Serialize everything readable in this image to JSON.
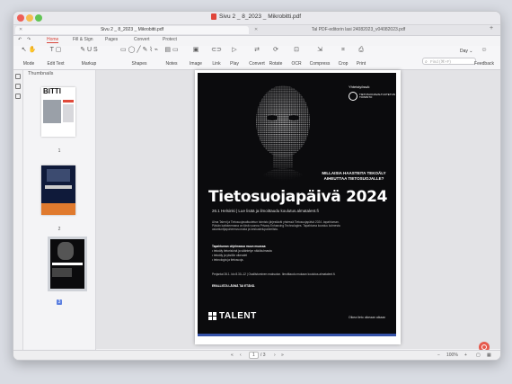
{
  "window": {
    "title": "Sivu 2 _ 8_2023 _ Mikrobitti.pdf"
  },
  "tabs": [
    {
      "label": "Sivu 2 _ 8_2023 _ Mikrobitti.pdf",
      "active": true
    },
    {
      "label": "Tal PDF-editorin lasi 24082023_v04082023.pdf",
      "active": false
    }
  ],
  "menu": [
    "Home",
    "Fill & Sign",
    "Pages",
    "Convert",
    "Protect"
  ],
  "toolbar": {
    "mode": "Mode",
    "edit_text": "Edit Text",
    "markup": "Markup",
    "shapes": "Shapes",
    "notes": "Notes",
    "image": "Image",
    "link": "Link",
    "play": "Play",
    "convert": "Convert",
    "rotate": "Rotate",
    "ocr": "OCR",
    "compress": "Compress",
    "crop": "Crop",
    "print": "Print",
    "feedback": "Feedback",
    "day": "Day",
    "search_placeholder": "Find (⌘+F)"
  },
  "sidebar": {
    "heading": "Thumbnails",
    "pages": [
      "1",
      "2",
      "3"
    ],
    "selected_page": 3
  },
  "poster": {
    "logo_line1": "Yhteistyössä:",
    "logo_line2": "TIETOSUOJAVALTUUTETUN TOIMISTO",
    "question": "MILLAISIA HAASTEITA TEKOÄLY AIHEUTTAA TIETOSUOJALLE?",
    "title": "Tietosuojapäivä 2024",
    "subtitle": "26.1 Helsinki | Lue lisää ja ilmoittaudu koulutus.almatalent.fi",
    "body": "Alma Talent ja Tietosuojavaltuutetun toimisto järjestävät yhdessä Tietosuojapäivä 2024 -tapahtuman. Päivän kattoteemana on tänä vuonna Privacy Enhancing Technologies. Tapahtuma koostuu kolmesta asiantuntijapuheenvuorosta ja keskustelupaneelista.",
    "bullets_title": "Tapahtuman ohjelmassa muun muassa:",
    "bullets": [
      "tekoäly tietoriskinä ja sääntelyn näkökulmasta",
      "tekoäly ja yksilön oikeudet",
      "teknologia ja tietosuoja."
    ],
    "date": "Perjantai 26.1. klo 8.30–12 | Osallistuminen maksuton. Ilmoittaudu mukaan koulutus.almatalent.fi.",
    "cta": "ERALLISTA LÄSNÄ TAI ETÄNÄ.",
    "brand": "TALENT",
    "footer": "Oikea tieto oikeaan aikaan"
  },
  "status": {
    "current_page": "1",
    "total_pages": "/ 3",
    "zoom": "100%"
  },
  "colors": {
    "accent": "#d8453a",
    "selected": "#5b7fe0",
    "poster_bg": "#0b0b0d",
    "poster_bar": "#3552a8"
  }
}
